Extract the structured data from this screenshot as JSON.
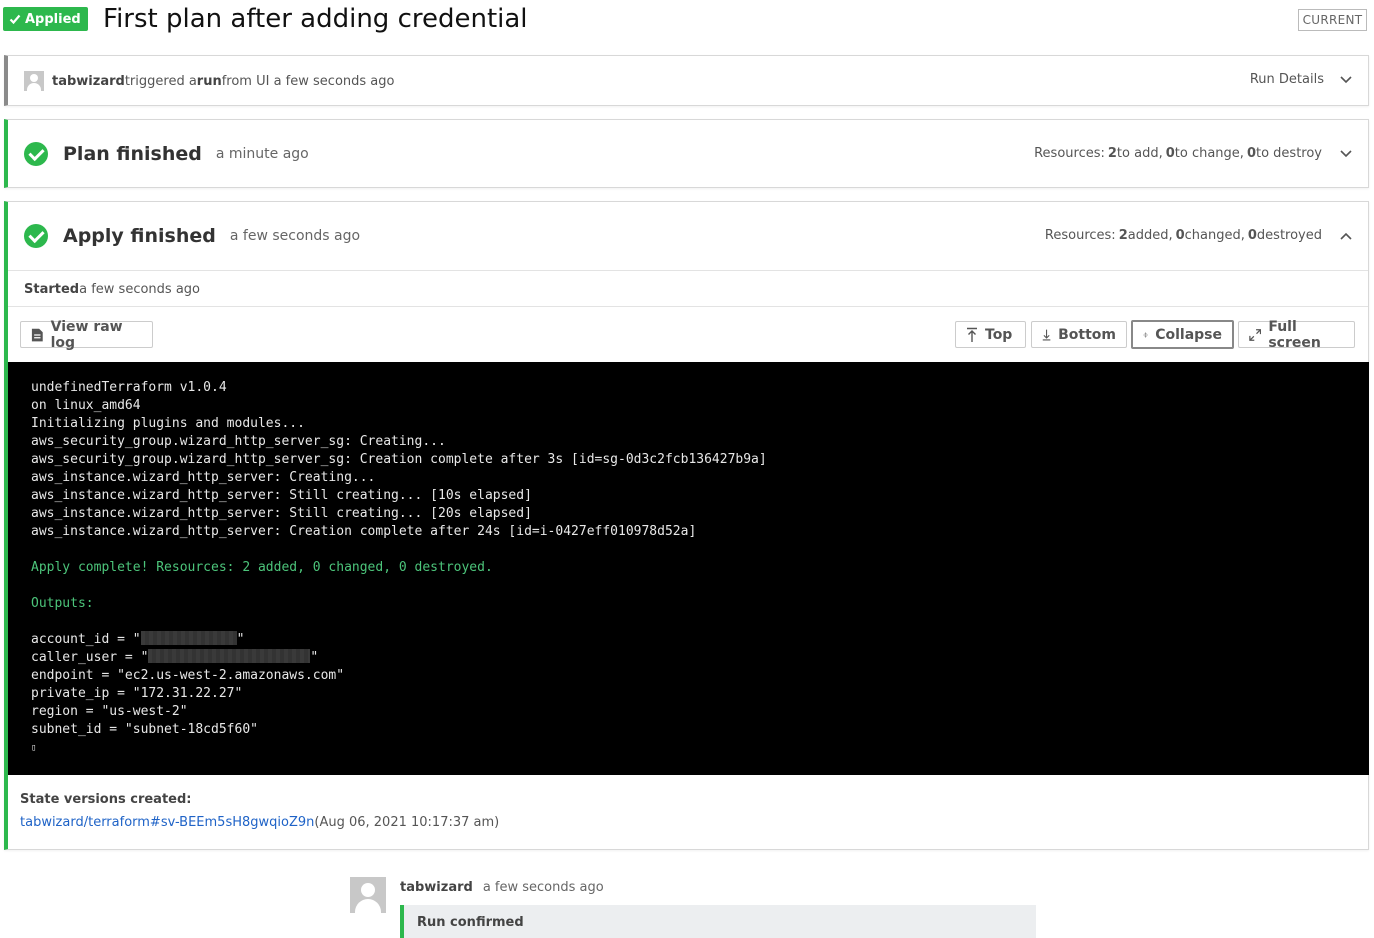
{
  "header": {
    "status_badge": "Applied",
    "title": "First plan after adding credential",
    "current_badge": "CURRENT"
  },
  "trigger": {
    "user": "tabwizard",
    "text1": " triggered a ",
    "run": "run",
    "text2": " from UI a few seconds ago",
    "details": "Run Details"
  },
  "plan": {
    "title": "Plan finished",
    "time": "a minute ago",
    "resources_prefix": "Resources: ",
    "add": "2",
    "add_label": " to add, ",
    "change": "0",
    "change_label": " to change, ",
    "destroy": "0",
    "destroy_label": " to destroy"
  },
  "apply": {
    "title": "Apply finished",
    "time": "a few seconds ago",
    "resources_prefix": "Resources: ",
    "added": "2",
    "added_label": " added, ",
    "changed": "0",
    "changed_label": " changed, ",
    "destroyed": "0",
    "destroyed_label": " destroyed",
    "started_label": "Started",
    "started_time": " a few seconds ago"
  },
  "toolbar": {
    "view_raw_log": "View raw log",
    "top": "Top",
    "bottom": "Bottom",
    "collapse": "Collapse",
    "full_screen": "Full screen"
  },
  "log": {
    "lines": [
      "undefinedTerraform v1.0.4",
      "on linux_amd64",
      "Initializing plugins and modules...",
      "aws_security_group.wizard_http_server_sg: Creating...",
      "aws_security_group.wizard_http_server_sg: Creation complete after 3s [id=sg-0d3c2fcb136427b9a]",
      "aws_instance.wizard_http_server: Creating...",
      "aws_instance.wizard_http_server: Still creating... [10s elapsed]",
      "aws_instance.wizard_http_server: Still creating... [20s elapsed]",
      "aws_instance.wizard_http_server: Creation complete after 24s [id=i-0427eff010978d52a]"
    ],
    "apply_complete": "Apply complete! Resources: 2 added, 0 changed, 0 destroyed.",
    "outputs_label": "Outputs:",
    "account_id_prefix": "account_id = \"",
    "account_id_suffix": "\"",
    "caller_user_prefix": "caller_user = \"",
    "caller_user_suffix": "\"",
    "outputs": [
      "endpoint = \"ec2.us-west-2.amazonaws.com\"",
      "private_ip = \"172.31.22.27\"",
      "region = \"us-west-2\"",
      "subnet_id = \"subnet-18cd5f60\""
    ],
    "end_glyph": "▯"
  },
  "state": {
    "label": "State versions created:",
    "link": "tabwizard/terraform#sv-BEEm5sH8gwqioZ9n",
    "date": " (Aug 06, 2021 10:17:37 am)"
  },
  "comment": {
    "user": "tabwizard",
    "time": "a few seconds ago",
    "message": "Run confirmed"
  },
  "colors": {
    "success": "#2db84d",
    "link": "#1f63c7",
    "terminal_bg": "#000000",
    "terminal_green": "#4cc47a"
  }
}
